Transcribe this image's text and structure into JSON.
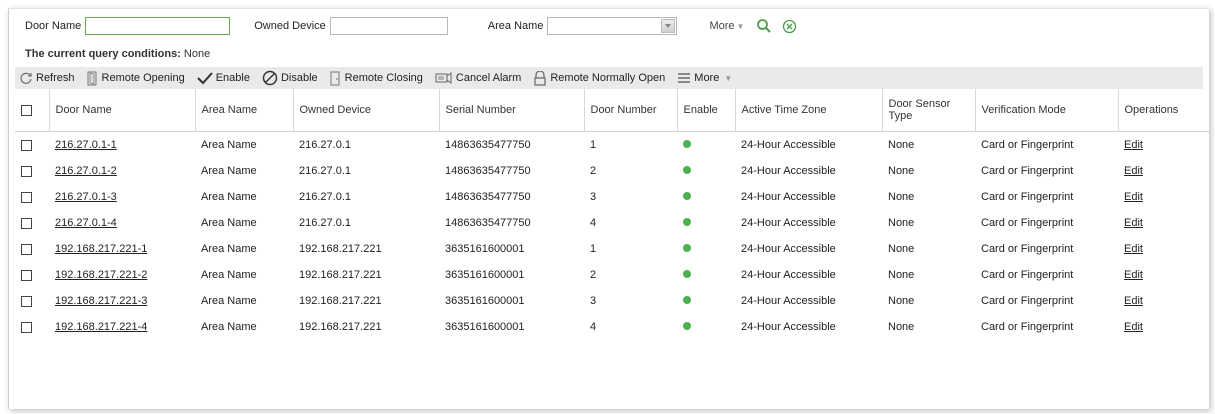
{
  "filters": {
    "door_name_label": "Door Name",
    "door_name_value": "",
    "owned_device_label": "Owned Device",
    "owned_device_value": "",
    "area_name_label": "Area Name",
    "area_name_value": "",
    "more_label": "More"
  },
  "conditions": {
    "label": "The current query conditions:",
    "value": "None"
  },
  "toolbar": {
    "refresh": "Refresh",
    "remote_opening": "Remote Opening",
    "enable": "Enable",
    "disable": "Disable",
    "remote_closing": "Remote Closing",
    "cancel_alarm": "Cancel Alarm",
    "remote_normally_open": "Remote Normally Open",
    "more": "More"
  },
  "table": {
    "headers": [
      "Door Name",
      "Area Name",
      "Owned Device",
      "Serial Number",
      "Door Number",
      "Enable",
      "Active Time Zone",
      "Door Sensor Type",
      "Verification Mode",
      "Operations"
    ],
    "rows": [
      {
        "door_name": "216.27.0.1-1",
        "area_name": "Area Name",
        "owned_device": "216.27.0.1",
        "serial": "14863635477750",
        "door_number": "1",
        "enabled": true,
        "time_zone": "24-Hour Accessible",
        "sensor_type": "None",
        "verification": "Card or Fingerprint",
        "operation": "Edit"
      },
      {
        "door_name": "216.27.0.1-2",
        "area_name": "Area Name",
        "owned_device": "216.27.0.1",
        "serial": "14863635477750",
        "door_number": "2",
        "enabled": true,
        "time_zone": "24-Hour Accessible",
        "sensor_type": "None",
        "verification": "Card or Fingerprint",
        "operation": "Edit"
      },
      {
        "door_name": "216.27.0.1-3",
        "area_name": "Area Name",
        "owned_device": "216.27.0.1",
        "serial": "14863635477750",
        "door_number": "3",
        "enabled": true,
        "time_zone": "24-Hour Accessible",
        "sensor_type": "None",
        "verification": "Card or Fingerprint",
        "operation": "Edit"
      },
      {
        "door_name": "216.27.0.1-4",
        "area_name": "Area Name",
        "owned_device": "216.27.0.1",
        "serial": "14863635477750",
        "door_number": "4",
        "enabled": true,
        "time_zone": "24-Hour Accessible",
        "sensor_type": "None",
        "verification": "Card or Fingerprint",
        "operation": "Edit"
      },
      {
        "door_name": "192.168.217.221-1",
        "area_name": "Area Name",
        "owned_device": "192.168.217.221",
        "serial": "3635161600001",
        "door_number": "1",
        "enabled": true,
        "time_zone": "24-Hour Accessible",
        "sensor_type": "None",
        "verification": "Card or Fingerprint",
        "operation": "Edit"
      },
      {
        "door_name": "192.168.217.221-2",
        "area_name": "Area Name",
        "owned_device": "192.168.217.221",
        "serial": "3635161600001",
        "door_number": "2",
        "enabled": true,
        "time_zone": "24-Hour Accessible",
        "sensor_type": "None",
        "verification": "Card or Fingerprint",
        "operation": "Edit"
      },
      {
        "door_name": "192.168.217.221-3",
        "area_name": "Area Name",
        "owned_device": "192.168.217.221",
        "serial": "3635161600001",
        "door_number": "3",
        "enabled": true,
        "time_zone": "24-Hour Accessible",
        "sensor_type": "None",
        "verification": "Card or Fingerprint",
        "operation": "Edit"
      },
      {
        "door_name": "192.168.217.221-4",
        "area_name": "Area Name",
        "owned_device": "192.168.217.221",
        "serial": "3635161600001",
        "door_number": "4",
        "enabled": true,
        "time_zone": "24-Hour Accessible",
        "sensor_type": "None",
        "verification": "Card or Fingerprint",
        "operation": "Edit"
      }
    ]
  },
  "colors": {
    "accent_green": "#4caf50",
    "toolbar_bg": "#eaeaea",
    "search_icon": "#4aa04a",
    "clear_icon": "#4aa04a"
  }
}
